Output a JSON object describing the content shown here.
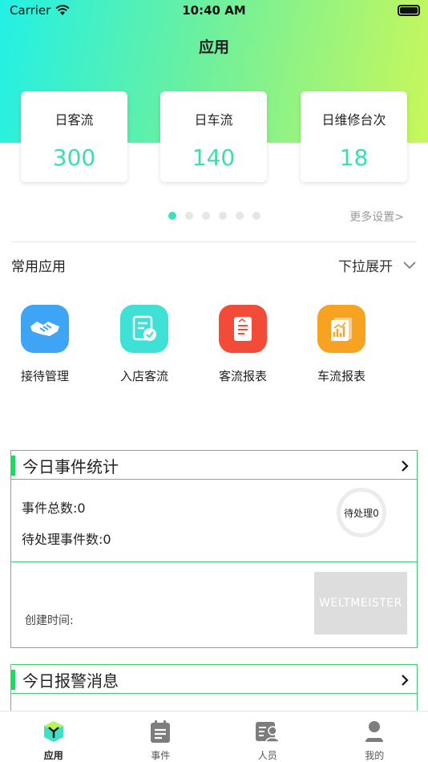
{
  "status_bar": {
    "carrier": "Carrier",
    "time": "10:40 AM"
  },
  "header": {
    "title": "应用"
  },
  "stats": [
    {
      "label": "日客流",
      "value": "300"
    },
    {
      "label": "日车流",
      "value": "140"
    },
    {
      "label": "日维修台次",
      "value": "18"
    }
  ],
  "carousel": {
    "dot_count": 6,
    "active_index": 0
  },
  "more_settings": "更多设置>",
  "common_apps": {
    "title": "常用应用",
    "expand_label": "下拉展开",
    "items": [
      {
        "label": "接待管理",
        "icon": "handshake-icon",
        "color": "#3ea4f5"
      },
      {
        "label": "入店客流",
        "icon": "document-check-icon",
        "color": "#3fe0d6"
      },
      {
        "label": "客流报表",
        "icon": "report-icon",
        "color": "#f24b37"
      },
      {
        "label": "车流报表",
        "icon": "chart-report-icon",
        "color": "#f7a321"
      }
    ]
  },
  "events_panel": {
    "title": "今日事件统计",
    "total": "事件总数:0",
    "pending": "待处理事件数:0",
    "ring_label": "待处理0",
    "created_label": "创建时间:",
    "thumbnail_text": "WELTMEISTER"
  },
  "alarm_panel": {
    "title": "今日报警消息"
  },
  "tabbar": {
    "items": [
      {
        "label": "应用",
        "icon": "apps-cube-icon",
        "active": true
      },
      {
        "label": "事件",
        "icon": "clipboard-icon",
        "active": false
      },
      {
        "label": "人员",
        "icon": "person-card-icon",
        "active": false
      },
      {
        "label": "我的",
        "icon": "user-icon",
        "active": false
      }
    ]
  },
  "colors": {
    "accent": "#3fdcae",
    "panel_border": "#38d76e",
    "panel_bar": "#1ed860"
  }
}
